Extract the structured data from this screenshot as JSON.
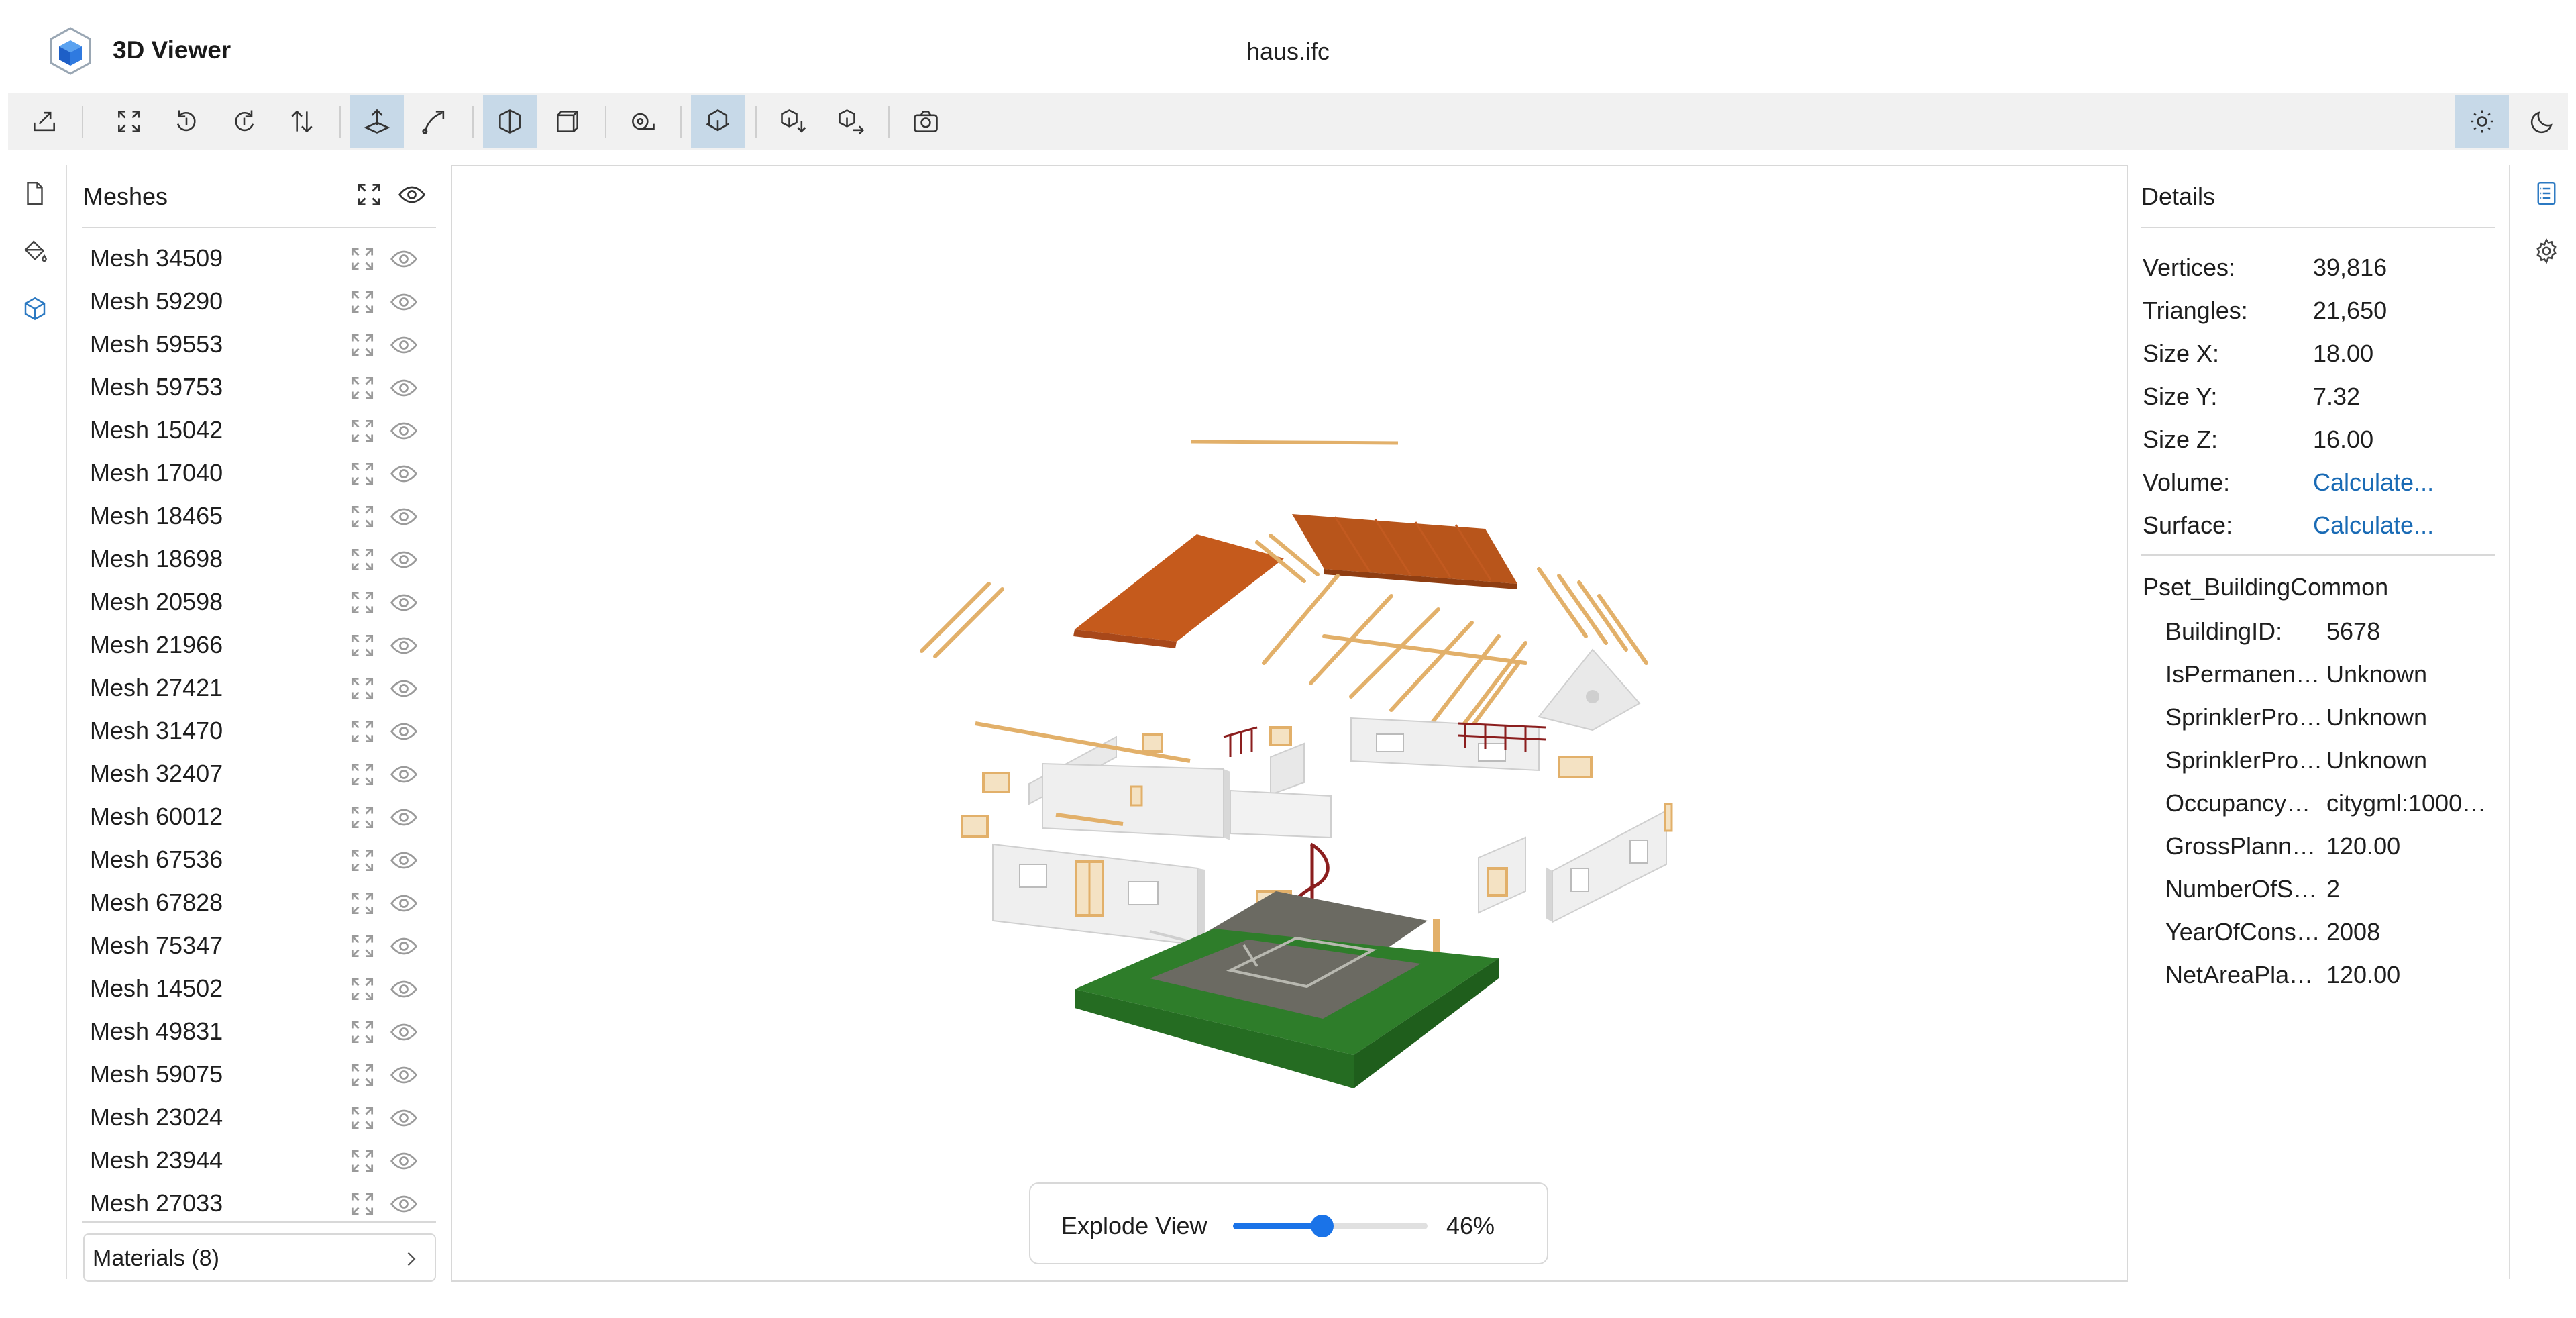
{
  "app": {
    "title": "3D Viewer",
    "file_name": "haus.ifc"
  },
  "toolbar": {
    "buttons": [
      {
        "name": "import-model-button",
        "icon": "import-icon",
        "active": false
      },
      {
        "name": "fit-to-window-button",
        "icon": "expand-icon",
        "active": false
      },
      {
        "name": "rotate-left-button",
        "icon": "rotate-left-icon",
        "active": false
      },
      {
        "name": "rotate-right-button",
        "icon": "rotate-right-icon",
        "active": false
      },
      {
        "name": "flip-up-vector-button",
        "icon": "flip-vertical-icon",
        "active": false
      },
      {
        "name": "fixed-up-vector-button",
        "icon": "up-vector-icon",
        "active": true
      },
      {
        "name": "free-orbit-button",
        "icon": "free-orbit-icon",
        "active": false
      },
      {
        "name": "perspective-camera-button",
        "icon": "perspective-icon",
        "active": true
      },
      {
        "name": "orthographic-camera-button",
        "icon": "orthographic-icon",
        "active": false
      },
      {
        "name": "measure-button",
        "icon": "measure-icon",
        "active": false
      },
      {
        "name": "cross-section-button",
        "icon": "section-icon",
        "active": true
      },
      {
        "name": "export-model-button",
        "icon": "export-icon",
        "active": false
      },
      {
        "name": "share-model-button",
        "icon": "share-icon",
        "active": false
      },
      {
        "name": "snapshot-button",
        "icon": "camera-icon",
        "active": false
      },
      {
        "name": "light-theme-button",
        "icon": "sun-icon",
        "active": true
      },
      {
        "name": "dark-theme-button",
        "icon": "moon-icon",
        "active": false
      }
    ]
  },
  "nav": {
    "items": [
      {
        "name": "nav-files",
        "icon": "file-icon"
      },
      {
        "name": "nav-materials",
        "icon": "paint-bucket-icon"
      },
      {
        "name": "nav-meshes",
        "icon": "cube-icon",
        "active": true
      }
    ]
  },
  "meshes_panel": {
    "title": "Meshes",
    "items": [
      "Mesh 34509",
      "Mesh 59290",
      "Mesh 59553",
      "Mesh 59753",
      "Mesh 15042",
      "Mesh 17040",
      "Mesh 18465",
      "Mesh 18698",
      "Mesh 20598",
      "Mesh 21966",
      "Mesh 27421",
      "Mesh 31470",
      "Mesh 32407",
      "Mesh 60012",
      "Mesh 67536",
      "Mesh 67828",
      "Mesh 75347",
      "Mesh 14502",
      "Mesh 49831",
      "Mesh 59075",
      "Mesh 23024",
      "Mesh 23944",
      "Mesh 27033"
    ],
    "materials_label": "Materials (8)"
  },
  "explode": {
    "label": "Explode View",
    "value_text": "46%",
    "value": 0.46
  },
  "details": {
    "title": "Details",
    "rows": [
      {
        "key": "Vertices:",
        "value": "39,816",
        "link": false
      },
      {
        "key": "Triangles:",
        "value": "21,650",
        "link": false
      },
      {
        "key": "Size X:",
        "value": "18.00",
        "link": false
      },
      {
        "key": "Size Y:",
        "value": "7.32",
        "link": false
      },
      {
        "key": "Size Z:",
        "value": "16.00",
        "link": false
      },
      {
        "key": "Volume:",
        "value": "Calculate...",
        "link": true
      },
      {
        "key": "Surface:",
        "value": "Calculate...",
        "link": true
      }
    ],
    "pset_title": "Pset_BuildingCommon",
    "pset_rows": [
      {
        "key": "BuildingID:",
        "value": "5678"
      },
      {
        "key": "IsPermanentID:",
        "value": "Unknown"
      },
      {
        "key": "SprinklerProtection:",
        "value": "Unknown"
      },
      {
        "key": "SprinklerProtectionAutomatic:",
        "value": "Unknown"
      },
      {
        "key": "OccupancyType:",
        "value": "citygml:1000 ..."
      },
      {
        "key": "GrossPlannedArea:",
        "value": "120.00"
      },
      {
        "key": "NumberOfStoreys:",
        "value": "2"
      },
      {
        "key": "YearOfConstruction:",
        "value": "2008"
      },
      {
        "key": "NetAreaPlanned:",
        "value": "120.00"
      }
    ]
  },
  "right_rail": {
    "items": [
      {
        "name": "details-panel-toggle",
        "icon": "details-icon",
        "active": true
      },
      {
        "name": "settings-button",
        "icon": "gear-icon",
        "active": false
      }
    ]
  },
  "colors": {
    "accent": "#1a73e8",
    "active_button": "#c7d9e8",
    "link": "#1a6bb5",
    "roof": "#c55a1c",
    "timber": "#e2b06a",
    "grass": "#2e7d2a",
    "slab": "#6b6a62"
  }
}
